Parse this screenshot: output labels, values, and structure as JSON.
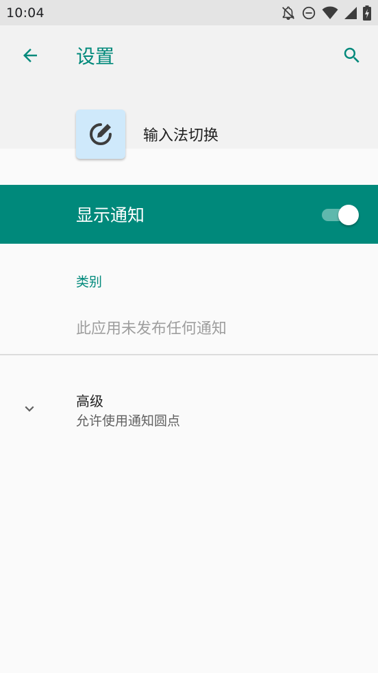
{
  "status_bar": {
    "time": "10:04",
    "icons": [
      "notifications-off-icon",
      "do-not-disturb-icon",
      "wifi-icon",
      "cell-signal-icon",
      "battery-charging-icon"
    ]
  },
  "app_bar": {
    "title": "设置",
    "back_icon": "arrow-back-icon",
    "search_icon": "search-icon"
  },
  "app": {
    "name": "输入法切换",
    "icon": "edit-pencil-icon",
    "icon_tile_color": "#cfe9fb"
  },
  "master_switch": {
    "label": "显示通知",
    "checked": true,
    "background_color": "#00897b"
  },
  "categories": {
    "header": "类别",
    "empty_text": "此应用未发布任何通知"
  },
  "advanced": {
    "title": "高级",
    "summary": "允许使用通知圆点",
    "icon": "chevron-down-icon"
  },
  "colors": {
    "accent": "#00897b",
    "status_bar_bg": "#e4e4e4",
    "header_bg": "#f2f2f2",
    "body_bg": "#fafafa"
  }
}
